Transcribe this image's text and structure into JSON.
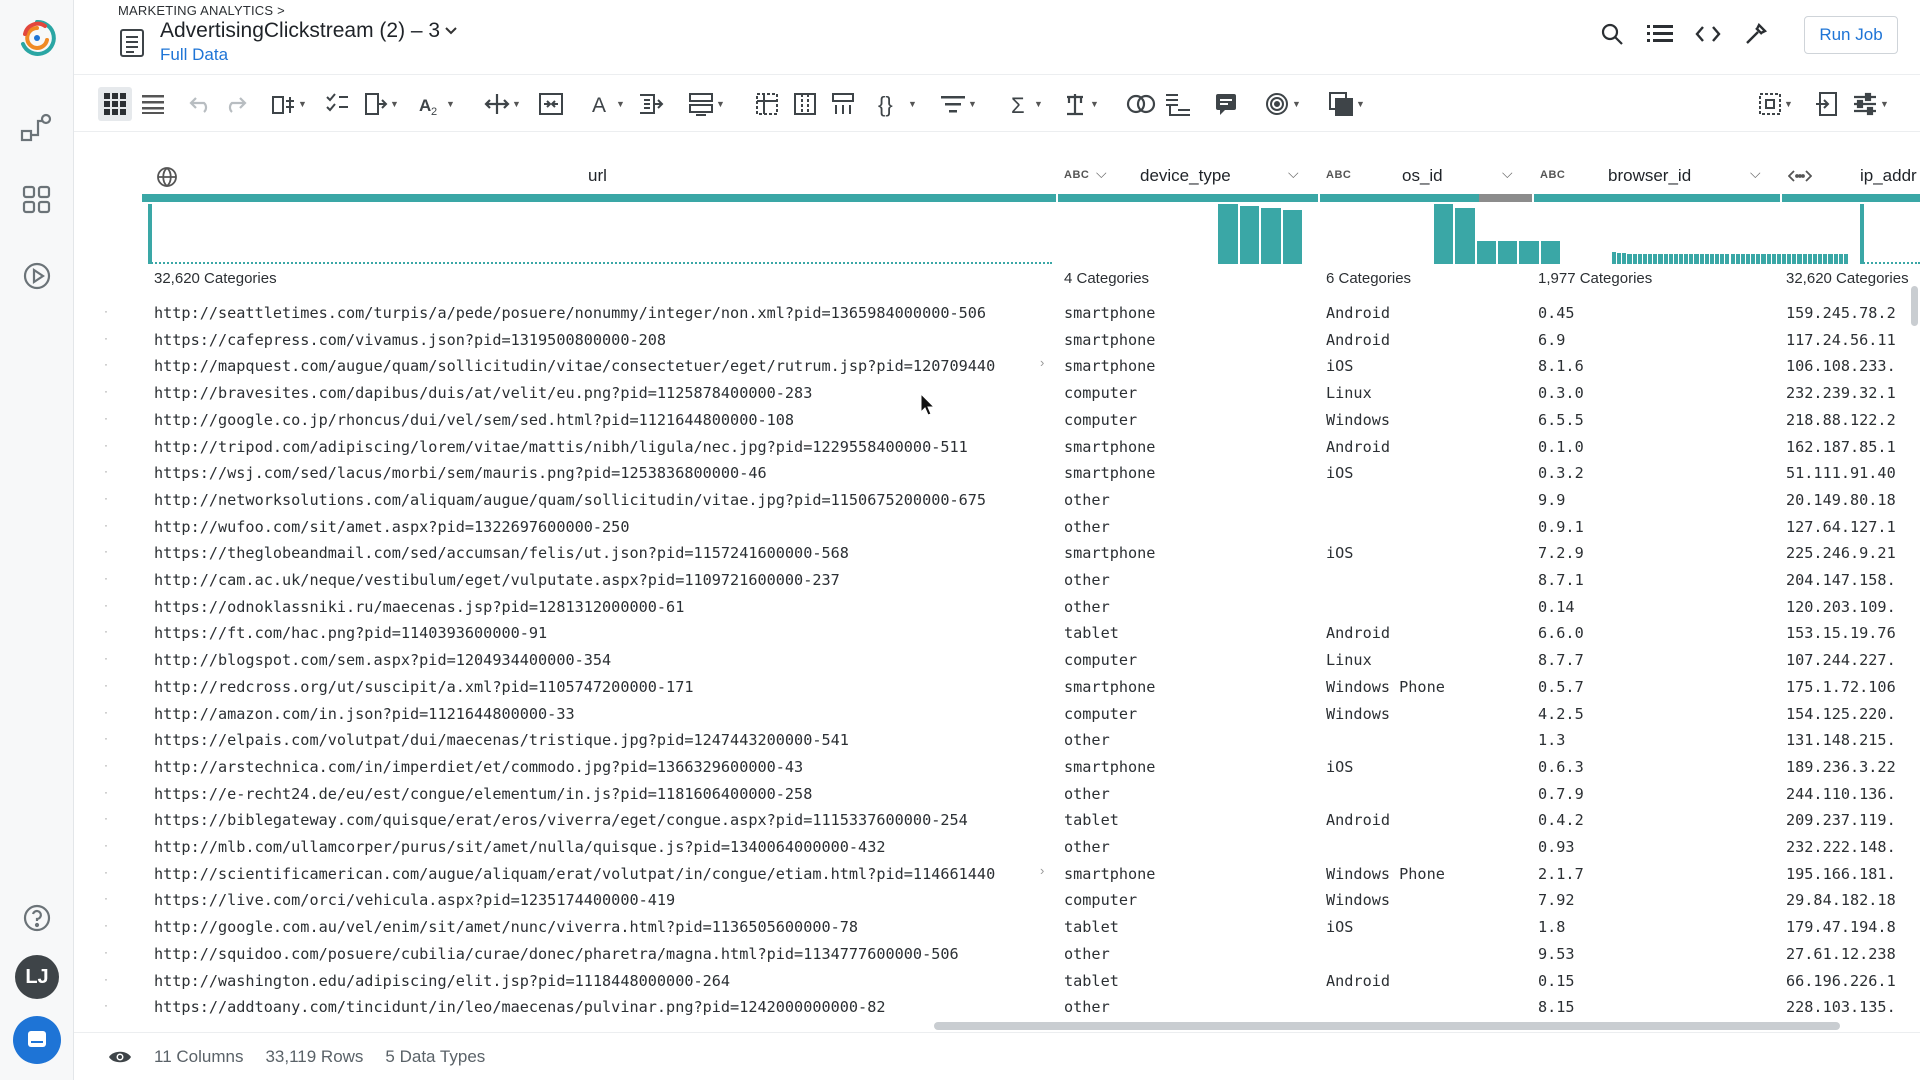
{
  "header": {
    "breadcrumb": "MARKETING ANALYTICS >",
    "title": "AdvertisingClickstream (2) – 3",
    "subtitle": "Full Data",
    "run_job_label": "Run Job"
  },
  "columns": [
    {
      "key": "url",
      "type_label": "",
      "name": "url",
      "categories": "32,620 Categories"
    },
    {
      "key": "device_type",
      "type_label": "ABC",
      "name": "device_type",
      "categories": "4 Categories"
    },
    {
      "key": "os_id",
      "type_label": "ABC",
      "name": "os_id",
      "categories": "6 Categories"
    },
    {
      "key": "browser_id",
      "type_label": "ABC",
      "name": "browser_id",
      "categories": "1,977 Categories"
    },
    {
      "key": "ip_addr",
      "type_label": "",
      "name": "ip_addr",
      "categories": "32,620 Categories"
    }
  ],
  "histograms": {
    "device_type": [
      1.0,
      0.96,
      0.94,
      0.9
    ],
    "os_id": [
      1.0,
      0.94,
      0.38,
      0.38,
      0.38,
      0.38
    ],
    "browser_id": [
      0.2,
      0.18,
      0.18,
      0.17,
      0.17,
      0.17,
      0.17,
      0.17,
      0.17,
      0.17,
      0.17,
      0.17,
      0.17,
      0.17,
      0.17,
      0.17,
      0.17,
      0.17,
      0.17,
      0.17,
      0.17,
      0.17,
      0.17,
      0.17,
      0.17,
      0.17,
      0.17,
      0.17,
      0.17,
      0.17,
      0.17,
      0.17,
      0.17,
      0.17,
      0.17,
      0.17,
      0.17,
      0.17,
      0.17,
      0.17,
      0.17,
      0.17,
      0.17,
      0.17,
      0.17,
      0.17
    ],
    "os_id_missing": 0.25
  },
  "rows": [
    {
      "url": "http://seattletimes.com/turpis/a/pede/posuere/nonummy/integer/non.xml?pid=1365984000000-506",
      "device_type": "smartphone",
      "os_id": "Android",
      "browser_id": "0.45",
      "ip_addr": "159.245.78.2"
    },
    {
      "url": "https://cafepress.com/vivamus.json?pid=1319500800000-208",
      "device_type": "smartphone",
      "os_id": "Android",
      "browser_id": "6.9",
      "ip_addr": "117.24.56.11"
    },
    {
      "url": "http://mapquest.com/augue/quam/sollicitudin/vitae/consectetuer/eget/rutrum.jsp?pid=120709440",
      "device_type": "smartphone",
      "os_id": "iOS",
      "browser_id": "8.1.6",
      "ip_addr": "106.108.233."
    },
    {
      "url": "http://bravesites.com/dapibus/duis/at/velit/eu.png?pid=1125878400000-283",
      "device_type": "computer",
      "os_id": "Linux",
      "browser_id": "0.3.0",
      "ip_addr": "232.239.32.1"
    },
    {
      "url": "http://google.co.jp/rhoncus/dui/vel/sem/sed.html?pid=1121644800000-108",
      "device_type": "computer",
      "os_id": "Windows",
      "browser_id": "6.5.5",
      "ip_addr": "218.88.122.2"
    },
    {
      "url": "http://tripod.com/adipiscing/lorem/vitae/mattis/nibh/ligula/nec.jpg?pid=1229558400000-511",
      "device_type": "smartphone",
      "os_id": "Android",
      "browser_id": "0.1.0",
      "ip_addr": "162.187.85.1"
    },
    {
      "url": "https://wsj.com/sed/lacus/morbi/sem/mauris.png?pid=1253836800000-46",
      "device_type": "smartphone",
      "os_id": "iOS",
      "browser_id": "0.3.2",
      "ip_addr": "51.111.91.40"
    },
    {
      "url": "http://networksolutions.com/aliquam/augue/quam/sollicitudin/vitae.jpg?pid=1150675200000-675",
      "device_type": "other",
      "os_id": "",
      "browser_id": "9.9",
      "ip_addr": "20.149.80.18"
    },
    {
      "url": "http://wufoo.com/sit/amet.aspx?pid=1322697600000-250",
      "device_type": "other",
      "os_id": "",
      "browser_id": "0.9.1",
      "ip_addr": "127.64.127.1"
    },
    {
      "url": "https://theglobeandmail.com/sed/accumsan/felis/ut.json?pid=1157241600000-568",
      "device_type": "smartphone",
      "os_id": "iOS",
      "browser_id": "7.2.9",
      "ip_addr": "225.246.9.21"
    },
    {
      "url": "http://cam.ac.uk/neque/vestibulum/eget/vulputate.aspx?pid=1109721600000-237",
      "device_type": "other",
      "os_id": "",
      "browser_id": "8.7.1",
      "ip_addr": "204.147.158."
    },
    {
      "url": "https://odnoklassniki.ru/maecenas.jsp?pid=1281312000000-61",
      "device_type": "other",
      "os_id": "",
      "browser_id": "0.14",
      "ip_addr": "120.203.109."
    },
    {
      "url": "https://ft.com/hac.png?pid=1140393600000-91",
      "device_type": "tablet",
      "os_id": "Android",
      "browser_id": "6.6.0",
      "ip_addr": "153.15.19.76"
    },
    {
      "url": "http://blogspot.com/sem.aspx?pid=1204934400000-354",
      "device_type": "computer",
      "os_id": "Linux",
      "browser_id": "8.7.7",
      "ip_addr": "107.244.227."
    },
    {
      "url": "http://redcross.org/ut/suscipit/a.xml?pid=1105747200000-171",
      "device_type": "smartphone",
      "os_id": "Windows Phone",
      "browser_id": "0.5.7",
      "ip_addr": "175.1.72.106"
    },
    {
      "url": "http://amazon.com/in.json?pid=1121644800000-33",
      "device_type": "computer",
      "os_id": "Windows",
      "browser_id": "4.2.5",
      "ip_addr": "154.125.220."
    },
    {
      "url": "https://elpais.com/volutpat/dui/maecenas/tristique.jpg?pid=1247443200000-541",
      "device_type": "other",
      "os_id": "",
      "browser_id": "1.3",
      "ip_addr": "131.148.215."
    },
    {
      "url": "http://arstechnica.com/in/imperdiet/et/commodo.jpg?pid=1366329600000-43",
      "device_type": "smartphone",
      "os_id": "iOS",
      "browser_id": "0.6.3",
      "ip_addr": "189.236.3.22"
    },
    {
      "url": "https://e-recht24.de/eu/est/congue/elementum/in.js?pid=1181606400000-258",
      "device_type": "other",
      "os_id": "",
      "browser_id": "0.7.9",
      "ip_addr": "244.110.136."
    },
    {
      "url": "https://biblegateway.com/quisque/erat/eros/viverra/eget/congue.aspx?pid=1115337600000-254",
      "device_type": "tablet",
      "os_id": "Android",
      "browser_id": "0.4.2",
      "ip_addr": "209.237.119."
    },
    {
      "url": "http://mlb.com/ullamcorper/purus/sit/amet/nulla/quisque.js?pid=1340064000000-432",
      "device_type": "other",
      "os_id": "",
      "browser_id": "0.93",
      "ip_addr": "232.222.148."
    },
    {
      "url": "http://scientificamerican.com/augue/aliquam/erat/volutpat/in/congue/etiam.html?pid=114661440",
      "device_type": "smartphone",
      "os_id": "Windows Phone",
      "browser_id": "2.1.7",
      "ip_addr": "195.166.181."
    },
    {
      "url": "https://live.com/orci/vehicula.aspx?pid=1235174400000-419",
      "device_type": "computer",
      "os_id": "Windows",
      "browser_id": "7.92",
      "ip_addr": "29.84.182.18"
    },
    {
      "url": "http://google.com.au/vel/enim/sit/amet/nunc/viverra.html?pid=1136505600000-78",
      "device_type": "tablet",
      "os_id": "iOS",
      "browser_id": "1.8",
      "ip_addr": "179.47.194.8"
    },
    {
      "url": "http://squidoo.com/posuere/cubilia/curae/donec/pharetra/magna.html?pid=1134777600000-506",
      "device_type": "other",
      "os_id": "",
      "browser_id": "9.53",
      "ip_addr": "27.61.12.238"
    },
    {
      "url": "http://washington.edu/adipiscing/elit.jsp?pid=1118448000000-264",
      "device_type": "tablet",
      "os_id": "Android",
      "browser_id": "0.15",
      "ip_addr": "66.196.226.1"
    },
    {
      "url": "https://addtoany.com/tincidunt/in/leo/maecenas/pulvinar.png?pid=1242000000000-82",
      "device_type": "other",
      "os_id": "",
      "browser_id": "8.15",
      "ip_addr": "228.103.135."
    }
  ],
  "footer": {
    "columns": "11 Columns",
    "rows": "33,119 Rows",
    "types": "5 Data Types"
  }
}
